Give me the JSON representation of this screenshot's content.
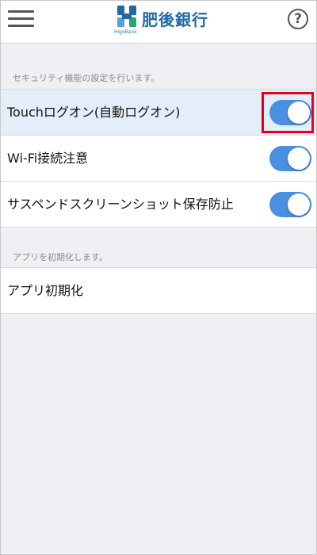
{
  "header": {
    "menu_icon": "hamburger-menu-icon",
    "logo_text": "肥後銀行",
    "logo_sub": "HigoBank",
    "help_icon": "help-circle-icon",
    "help_glyph": "?"
  },
  "colors": {
    "toggle_on": "#4a90e2",
    "highlight_row": "#e4eef9",
    "annotation_box": "#e8001c",
    "background": "#efeff4",
    "logo": "#1f6aa5"
  },
  "security_section": {
    "header": "セキュリティ機能の設定を行います。",
    "items": [
      {
        "label": "Touchログオン(自動ログオン)",
        "enabled": true
      },
      {
        "label": "Wi-Fi接続注意",
        "enabled": true
      },
      {
        "label": "サスペンドスクリーンショット保存防止",
        "enabled": true
      }
    ]
  },
  "init_section": {
    "header": "アプリを初期化します。",
    "items": [
      {
        "label": "アプリ初期化"
      }
    ]
  }
}
